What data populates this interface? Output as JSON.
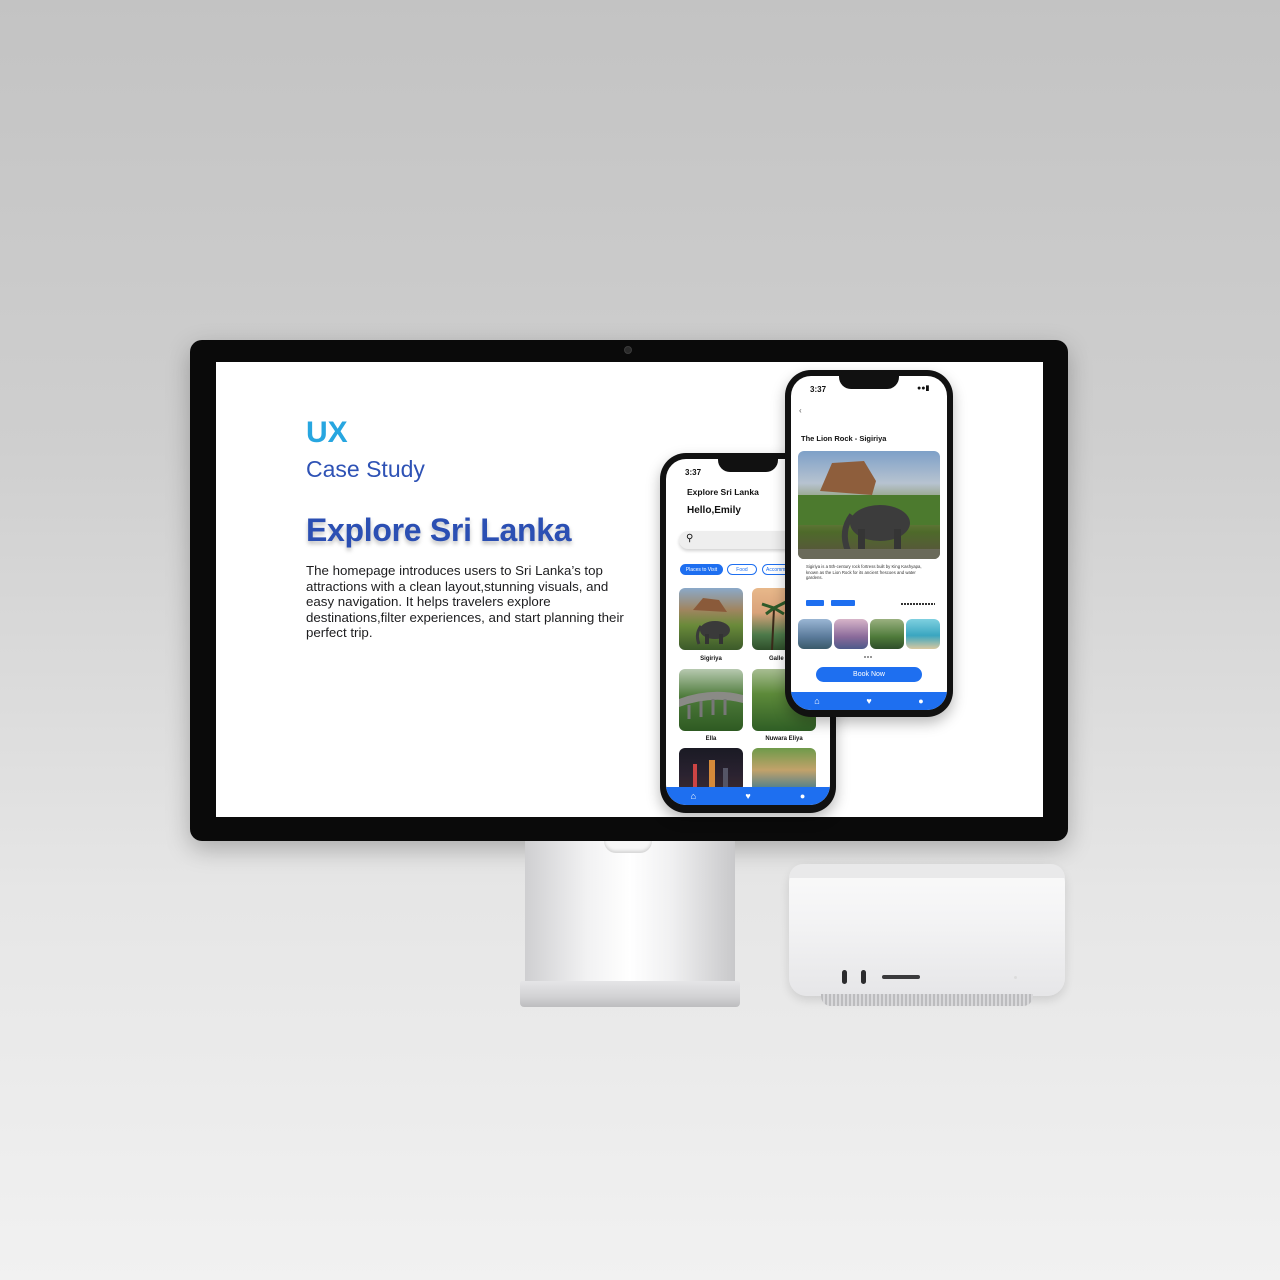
{
  "colors": {
    "accent_blue": "#1e6ff0",
    "ux_cyan": "#27a6e0",
    "heading_blue": "#2b4fb3"
  },
  "slide": {
    "ux": "UX",
    "case_study": "Case Study",
    "headline": "Explore Sri Lanka",
    "description": "The homepage introduces users to Sri Lanka’s top attractions with a clean layout,stunning visuals, and easy navigation. It helps travelers explore destinations,filter experiences, and start planning their perfect trip."
  },
  "home_phone": {
    "time": "3:37",
    "title": "Explore Sri Lanka",
    "greeting": "Hello,Emily",
    "search_icon": "search-icon",
    "chips": [
      "Places to Visit",
      "Food",
      "Accommodation"
    ],
    "places": [
      "Sigiriya",
      "Galle",
      "Ella",
      "Nuwara Eliya"
    ],
    "tabs": [
      "home-icon",
      "heart-icon",
      "profile-icon"
    ]
  },
  "detail_phone": {
    "time": "3:37",
    "back_icon": "chevron-left-icon",
    "title": "The Lion Rock -  Sigiriya",
    "description": "Sigiriya is a 5th-century rock fortress built by King Kashyapa, known as the Lion Rock for its ancient frescoes and water gardens.",
    "book_button": "Book Now",
    "tabs": [
      "home-icon",
      "heart-icon",
      "profile-icon"
    ]
  }
}
